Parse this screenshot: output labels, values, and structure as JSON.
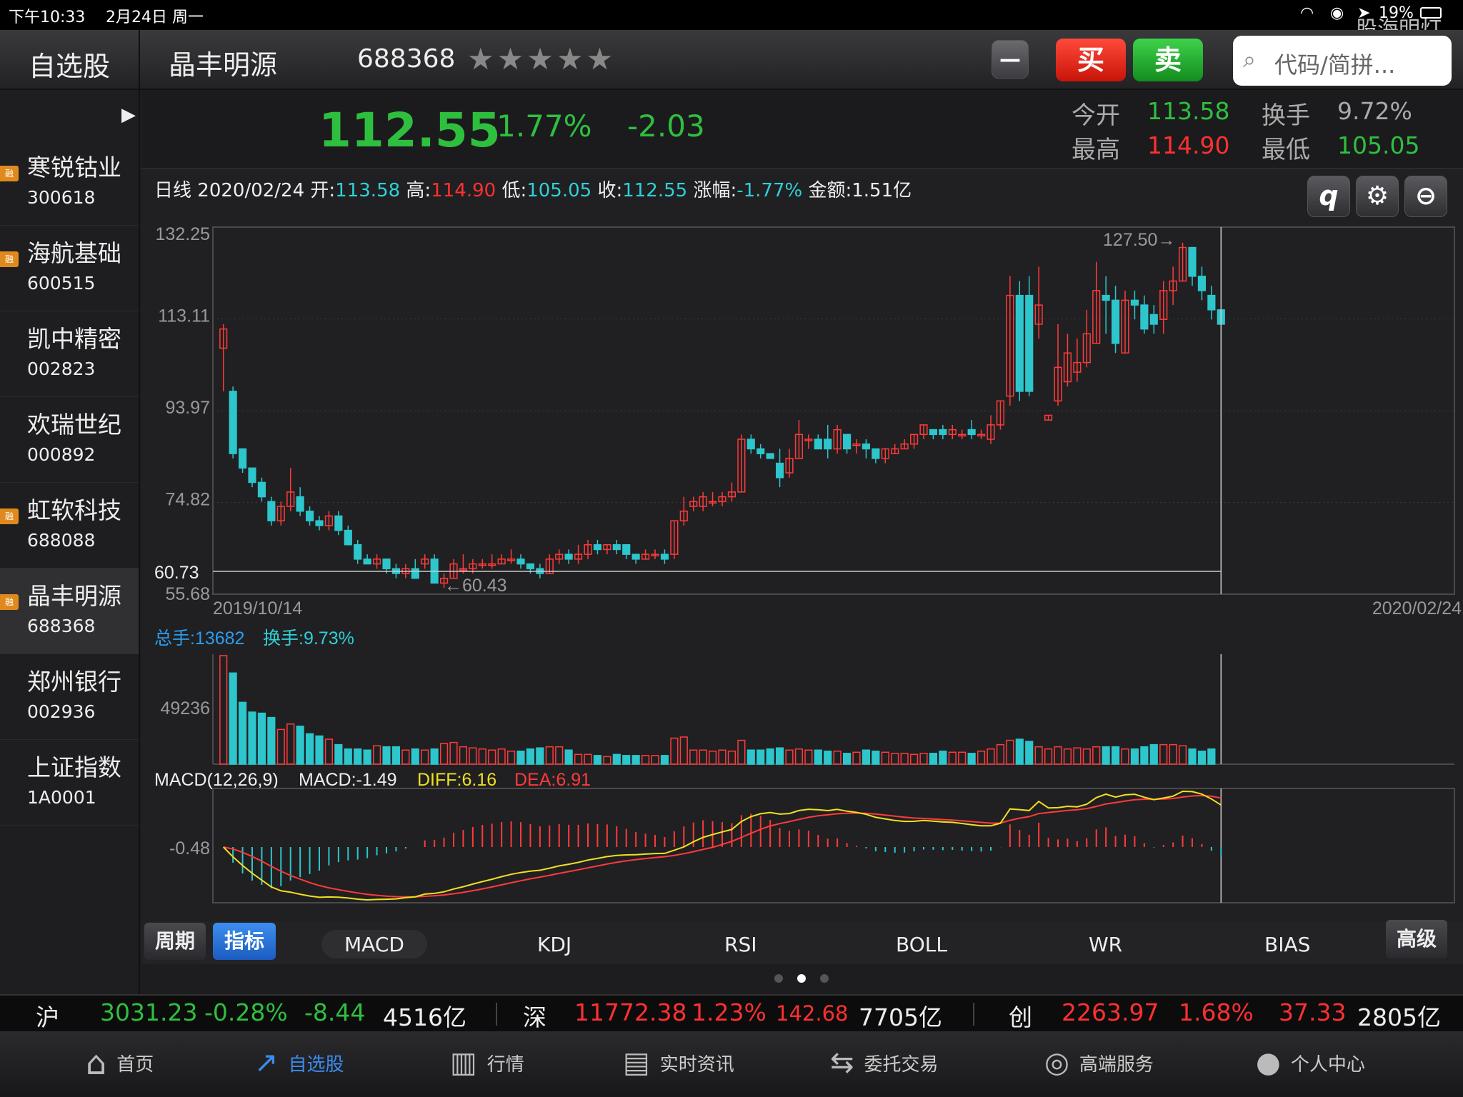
{
  "status": {
    "time": "下午10:33",
    "date": "2月24日 周一",
    "battery": "19%",
    "watermark": "股海明灯"
  },
  "header": {
    "tab": "自选股",
    "stock_name": "晶丰明源",
    "stock_code": "688368",
    "stars": "★★★★★",
    "minus": "—",
    "buy": "买",
    "sell": "卖",
    "search_placeholder": "代码/简拼..."
  },
  "sidebar": {
    "items": [
      {
        "name": "寒锐钴业",
        "code": "300618",
        "rong": true
      },
      {
        "name": "海航基础",
        "code": "600515",
        "rong": true
      },
      {
        "name": "凯中精密",
        "code": "002823",
        "rong": false
      },
      {
        "name": "欢瑞世纪",
        "code": "000892",
        "rong": false
      },
      {
        "name": "虹软科技",
        "code": "688088",
        "rong": true
      },
      {
        "name": "晶丰明源",
        "code": "688368",
        "rong": true
      },
      {
        "name": "郑州银行",
        "code": "002936",
        "rong": false
      },
      {
        "name": "上证指数",
        "code": "1A0001",
        "rong": false
      }
    ],
    "rong_label": "融"
  },
  "quote": {
    "price": "112.55",
    "pct": "-1.77%",
    "chg": "-2.03",
    "open_label": "今开",
    "open": "113.58",
    "turnover_label": "换手",
    "turnover": "9.72%",
    "high_label": "最高",
    "high": "114.90",
    "low_label": "最低",
    "low": "105.05"
  },
  "kline_info": {
    "period": "日线",
    "date": "2020/02/24",
    "open_label": "开:",
    "open": "113.58",
    "high_label": "高:",
    "high": "114.90",
    "low_label": "低:",
    "low": "105.05",
    "close_label": "收:",
    "close": "112.55",
    "pct_label": "涨幅:",
    "pct": "-1.77%",
    "amount_label": "金额:",
    "amount": "1.51亿"
  },
  "tool_icons": [
    "q",
    "gear-icon",
    "zoom-out-icon"
  ],
  "chart_data": {
    "type": "candlestick",
    "start_date": "2019/10/14",
    "end_date": "2020/02/24",
    "y_ticks": [
      "132.25",
      "113.11",
      "93.97",
      "74.82",
      "55.68"
    ],
    "ylim": [
      55.68,
      132.25
    ],
    "high_marker": "127.50→",
    "low_marker": "←60.43",
    "crosshair_label": "60.73",
    "candles": [
      [
        107,
        111,
        98,
        112
      ],
      [
        98,
        85,
        84,
        99
      ],
      [
        86,
        82,
        81,
        86
      ],
      [
        82,
        79,
        78,
        82
      ],
      [
        79,
        76,
        75,
        80
      ],
      [
        75,
        71,
        70,
        76
      ],
      [
        71,
        74,
        70,
        75
      ],
      [
        74,
        77,
        73,
        82
      ],
      [
        76,
        73,
        72,
        78
      ],
      [
        73,
        71,
        70,
        74
      ],
      [
        71,
        70,
        69,
        72
      ],
      [
        70,
        72,
        69,
        73
      ],
      [
        72,
        69,
        68,
        73
      ],
      [
        69,
        66,
        66,
        70
      ],
      [
        66,
        63,
        62,
        67
      ],
      [
        63,
        62,
        62,
        64
      ],
      [
        62,
        63,
        61,
        64
      ],
      [
        63,
        61,
        60,
        63
      ],
      [
        61,
        60,
        59,
        62
      ],
      [
        60,
        61,
        59,
        62
      ],
      [
        61,
        59,
        59,
        63
      ],
      [
        62,
        63,
        61,
        64
      ],
      [
        63,
        58,
        58,
        64
      ],
      [
        58,
        59,
        57,
        60
      ],
      [
        59,
        62,
        59,
        63
      ],
      [
        61,
        61,
        60,
        64
      ],
      [
        61,
        62,
        60,
        63
      ],
      [
        62,
        62,
        61,
        63
      ],
      [
        62,
        62,
        61,
        64
      ],
      [
        62,
        63,
        62,
        64
      ],
      [
        63,
        63,
        62,
        65
      ],
      [
        63,
        62,
        61,
        64
      ],
      [
        62,
        61,
        60,
        62
      ],
      [
        61,
        60,
        59,
        62
      ],
      [
        60,
        63,
        60,
        64
      ],
      [
        63,
        64,
        62,
        65
      ],
      [
        64,
        63,
        62,
        65
      ],
      [
        63,
        64,
        62,
        66
      ],
      [
        64,
        66,
        63,
        67
      ],
      [
        66,
        65,
        64,
        67
      ],
      [
        65,
        66,
        64,
        66
      ],
      [
        66,
        65,
        64,
        67
      ],
      [
        66,
        64,
        63,
        66
      ],
      [
        64,
        63,
        62,
        64
      ],
      [
        63,
        64,
        63,
        65
      ],
      [
        64,
        64,
        63,
        65
      ],
      [
        64,
        63,
        62,
        65
      ],
      [
        64,
        71,
        63,
        71
      ],
      [
        71,
        73,
        70,
        76
      ],
      [
        74,
        75,
        73,
        76
      ],
      [
        74,
        76,
        73,
        77
      ],
      [
        75,
        75,
        74,
        77
      ],
      [
        75,
        76,
        74,
        77
      ],
      [
        76,
        77,
        75,
        79
      ],
      [
        77,
        88,
        77,
        89
      ],
      [
        88,
        86,
        85,
        89
      ],
      [
        86,
        85,
        84,
        87
      ],
      [
        85,
        84,
        84,
        85
      ],
      [
        83,
        80,
        78,
        86
      ],
      [
        81,
        84,
        80,
        86
      ],
      [
        84,
        89,
        84,
        92
      ],
      [
        88,
        88,
        86,
        89
      ],
      [
        88,
        86,
        86,
        89
      ],
      [
        88,
        86,
        84,
        91
      ],
      [
        86,
        90,
        85,
        91
      ],
      [
        89,
        86,
        85,
        89
      ],
      [
        87,
        87,
        85,
        88
      ],
      [
        87,
        86,
        84,
        88
      ],
      [
        86,
        84,
        83,
        86
      ],
      [
        84,
        86,
        83,
        86
      ],
      [
        85,
        86,
        85,
        87
      ],
      [
        86,
        87,
        86,
        88
      ],
      [
        87,
        89,
        86,
        89
      ],
      [
        89,
        91,
        88,
        91
      ],
      [
        90,
        89,
        88,
        90
      ],
      [
        90,
        89,
        88,
        91
      ],
      [
        89,
        90,
        88,
        91
      ],
      [
        89,
        89,
        88,
        90
      ],
      [
        90,
        89,
        88,
        92
      ],
      [
        89,
        89,
        88,
        90
      ],
      [
        88,
        91,
        87,
        93
      ],
      [
        91,
        96,
        90,
        96
      ],
      [
        97,
        118,
        95,
        122
      ],
      [
        118,
        98,
        96,
        121
      ],
      [
        118,
        98,
        97,
        122
      ],
      [
        112,
        116,
        109,
        124
      ],
      [
        92,
        93,
        92,
        93
      ],
      [
        96,
        103,
        95,
        112
      ],
      [
        100,
        106,
        99,
        110
      ],
      [
        102,
        104,
        100,
        109
      ],
      [
        104,
        110,
        103,
        115
      ],
      [
        108,
        119,
        108,
        125
      ],
      [
        118,
        117,
        110,
        122
      ],
      [
        117,
        108,
        106,
        120
      ],
      [
        106,
        117,
        106,
        119
      ],
      [
        117,
        116,
        113,
        119
      ],
      [
        116,
        111,
        110,
        118
      ],
      [
        114,
        112,
        110,
        116
      ],
      [
        113,
        119,
        110,
        121
      ],
      [
        119,
        121,
        116,
        124
      ],
      [
        121,
        128,
        121,
        129
      ],
      [
        128,
        122,
        120,
        128
      ],
      [
        122,
        119,
        117,
        124
      ],
      [
        118,
        115,
        113,
        120
      ],
      [
        115,
        112,
        105,
        115
      ]
    ],
    "volume_label": "总手:13682",
    "turnover_label": "换手:9.73%",
    "volume_tick": "49236",
    "volumes": [
      100,
      84,
      57,
      48,
      47,
      43,
      32,
      37,
      35,
      28,
      26,
      23,
      18,
      14,
      14,
      13,
      17,
      16,
      16,
      13,
      14,
      13,
      14,
      19,
      20,
      16,
      15,
      14,
      13,
      14,
      12,
      12,
      14,
      15,
      16,
      16,
      13,
      9,
      9,
      8,
      7,
      9,
      8,
      8,
      8,
      8,
      8,
      24,
      25,
      13,
      13,
      12,
      13,
      12,
      22,
      13,
      13,
      14,
      15,
      13,
      14,
      13,
      13,
      12,
      12,
      10,
      11,
      13,
      12,
      11,
      10,
      10,
      9,
      10,
      10,
      12,
      11,
      11,
      10,
      12,
      14,
      18,
      22,
      23,
      21,
      16,
      14,
      16,
      14,
      15,
      14,
      16,
      16,
      16,
      14,
      14,
      16,
      18,
      18,
      18,
      17,
      14,
      12,
      14
    ],
    "macd_label": "MACD(12,26,9)",
    "macd_value": "MACD:-1.49",
    "diff_value": "DIFF:6.16",
    "dea_value": "DEA:6.91",
    "macd_tick": "-0.48"
  },
  "tabs": {
    "period": "周期",
    "indicator": "指标",
    "advanced": "高级",
    "indicators": [
      "MACD",
      "KDJ",
      "RSI",
      "BOLL",
      "WR",
      "BIAS"
    ]
  },
  "ticker": {
    "sh": {
      "label": "沪",
      "price": "3031.23",
      "pct": "-0.28%",
      "chg": "-8.44",
      "amount": "4516亿"
    },
    "sz": {
      "label": "深",
      "price": "11772.38",
      "pct": "1.23%",
      "chg": "142.68",
      "amount": "7705亿"
    },
    "cy": {
      "label": "创",
      "price": "2263.97",
      "pct": "1.68%",
      "chg": "37.33",
      "amount": "2805亿"
    }
  },
  "nav": [
    {
      "label": "首页",
      "icon": "home-icon"
    },
    {
      "label": "自选股",
      "icon": "trend-icon"
    },
    {
      "label": "行情",
      "icon": "market-icon"
    },
    {
      "label": "实时资讯",
      "icon": "news-icon"
    },
    {
      "label": "委托交易",
      "icon": "trade-icon"
    },
    {
      "label": "高端服务",
      "icon": "service-icon"
    },
    {
      "label": "个人中心",
      "icon": "user-icon"
    }
  ],
  "colors": {
    "up": "#ff3a3a",
    "down": "#2cc6cc",
    "accent": "#2d7fe0",
    "green": "#2fbf3f",
    "red": "#ff3030"
  }
}
